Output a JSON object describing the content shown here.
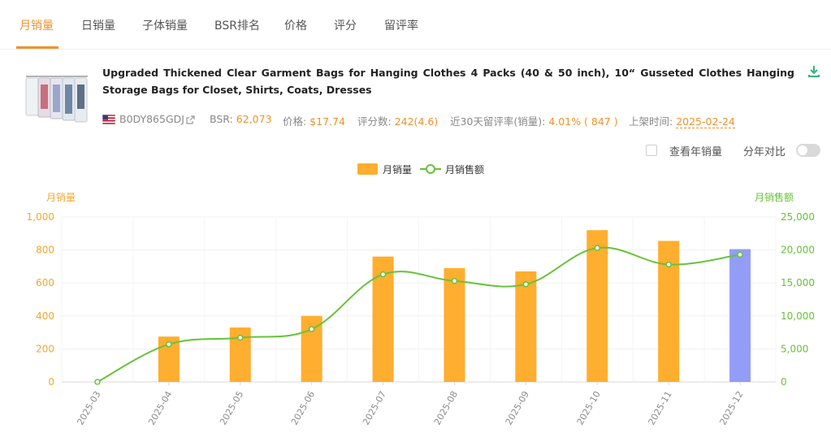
{
  "tabs": [
    {
      "label": "月销量",
      "active": true
    },
    {
      "label": "日销量",
      "active": false
    },
    {
      "label": "子体销量",
      "active": false
    },
    {
      "label": "BSR排名",
      "active": false
    },
    {
      "label": "价格",
      "active": false
    },
    {
      "label": "评分",
      "active": false
    },
    {
      "label": "留评率",
      "active": false
    }
  ],
  "product": {
    "title": "Upgraded Thickened Clear Garment Bags for Hanging Clothes 4 Packs (40 & 50 inch), 10“ Gusseted Clothes Hanging Storage Bags for Closet, Shirts, Coats, Dresses",
    "asin": "B0DY865GDJ",
    "bsr_label": "BSR:",
    "bsr": "62,073",
    "price_label": "价格:",
    "price": "$17.74",
    "reviews_label": "评分数:",
    "reviews": "242(4.6)",
    "return_label": "近30天留评率(销量):",
    "return_rate": "4.01% ( 847 )",
    "launch_label": "上架时间:",
    "launch_date": "2025-02-24"
  },
  "controls": {
    "year_sales_label": "查看年销量",
    "year_compare_label": "分年对比"
  },
  "legend": {
    "bar_label": "月销量",
    "line_label": "月销售额"
  },
  "colors": {
    "accent": "#f0922b",
    "bar": "#ffae2f",
    "bar_current": "#939df7",
    "line": "#67c23a",
    "download": "#36b37e"
  },
  "chart_data": {
    "type": "bar",
    "categories": [
      "2025-03",
      "2025-04",
      "2025-05",
      "2025-06",
      "2025-07",
      "2025-08",
      "2025-09",
      "2025-10",
      "2025-11",
      "2025-12"
    ],
    "series": [
      {
        "name": "月销量",
        "type": "bar",
        "axis": "left",
        "values": [
          0,
          275,
          330,
          400,
          760,
          690,
          670,
          920,
          855,
          805
        ]
      },
      {
        "name": "月销售额",
        "type": "line",
        "axis": "right",
        "values": [
          0,
          5700,
          6700,
          8000,
          16300,
          15300,
          14800,
          20300,
          17800,
          19300
        ]
      }
    ],
    "ylabel": "月销量",
    "ylabel_right": "月销售额",
    "ylim": [
      0,
      1000
    ],
    "ylim_right": [
      0,
      25000
    ],
    "yticks": [
      "0",
      "200",
      "400",
      "600",
      "800",
      "1,000"
    ],
    "yticks_right": [
      "0",
      "5,000",
      "10,000",
      "15,000",
      "20,000",
      "25,000"
    ],
    "grid": true,
    "legend_position": "top-center"
  }
}
